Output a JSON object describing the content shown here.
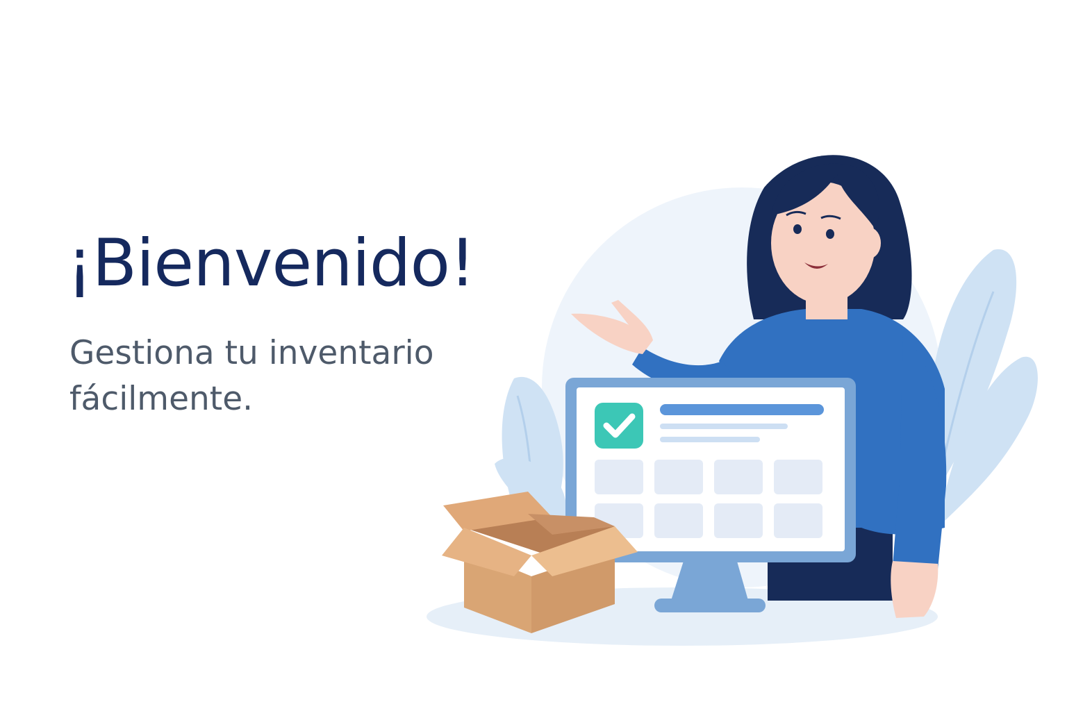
{
  "welcome": {
    "title": "¡Bienvenido!",
    "subtitle": "Gestiona tu inventario fácilmente."
  },
  "colors": {
    "title": "#15295e",
    "subtitle": "#4e5a6a",
    "shirt": "#3171c1",
    "hair": "#172b58",
    "skin": "#f8d2c4",
    "box": "#d9a574",
    "check_badge": "#3cc7b6",
    "monitor_frame": "#7aa6d6",
    "leaves": "#cfe2f4",
    "backdrop": "#eef4fb"
  },
  "icons": {
    "check": "check-icon",
    "box": "box-icon",
    "monitor": "monitor-icon"
  }
}
